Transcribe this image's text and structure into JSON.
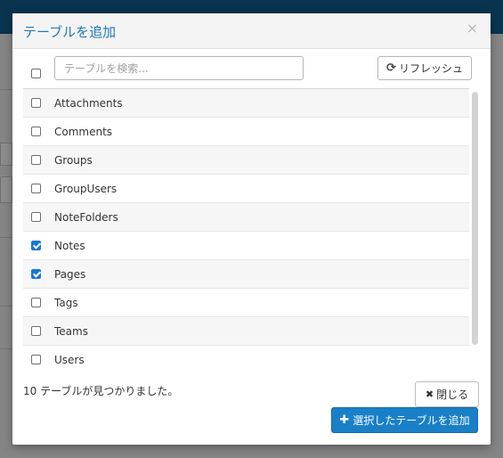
{
  "dialog": {
    "title": "テーブルを追加",
    "close_glyph": "×"
  },
  "search": {
    "placeholder": "テーブルを検索..."
  },
  "refresh": {
    "icon": "refresh-icon",
    "glyph": "⟳",
    "label": "リフレッシュ"
  },
  "select_all": {
    "checked": false
  },
  "tables": [
    {
      "name": "Attachments",
      "checked": false
    },
    {
      "name": "Comments",
      "checked": false
    },
    {
      "name": "Groups",
      "checked": false
    },
    {
      "name": "GroupUsers",
      "checked": false
    },
    {
      "name": "NoteFolders",
      "checked": false
    },
    {
      "name": "Notes",
      "checked": true
    },
    {
      "name": "Pages",
      "checked": true
    },
    {
      "name": "Tags",
      "checked": false
    },
    {
      "name": "Teams",
      "checked": false
    },
    {
      "name": "Users",
      "checked": false
    }
  ],
  "footer": {
    "found_text": "10 テーブルが見つかりました。",
    "close_label": "閉じる",
    "close_glyph": "✖",
    "add_label": "選択したテーブルを追加",
    "add_glyph": "✚"
  },
  "colors": {
    "accent": "#1980c8",
    "title": "#1f7ab7",
    "checkbox_checked": "#1877d2"
  }
}
